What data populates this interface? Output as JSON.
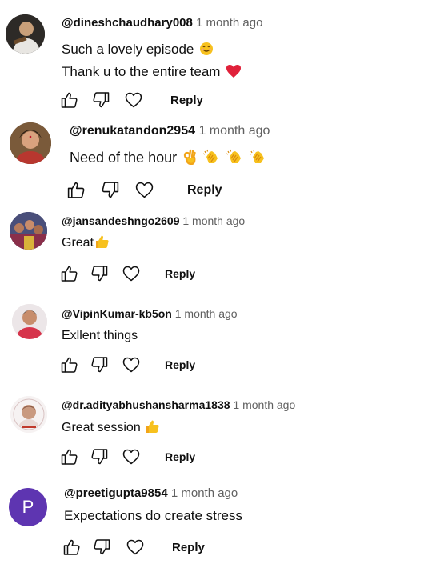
{
  "comments": [
    {
      "author": "@dineshchaudhary008",
      "time": "1 month ago",
      "lines": [
        "Such a lovely episode",
        "Thank u to the entire team"
      ],
      "reply_label": "Reply"
    },
    {
      "author": "@renukatandon2954",
      "time": "1 month ago",
      "lines": [
        "Need of the hour"
      ],
      "reply_label": "Reply"
    },
    {
      "author": "@jansandeshngo2609",
      "time": "1 month ago",
      "lines": [
        "Great"
      ],
      "reply_label": "Reply"
    },
    {
      "author": "@VipinKumar-kb5on",
      "time": "1 month ago",
      "lines": [
        "Exllent things"
      ],
      "reply_label": "Reply"
    },
    {
      "author": "@dr.adityabhushansharma1838",
      "time": "1 month ago",
      "lines": [
        "Great session"
      ],
      "reply_label": "Reply"
    },
    {
      "author": "@preetigupta9854",
      "time": "1 month ago",
      "lines": [
        "Expectations do create stress"
      ],
      "reply_label": "Reply",
      "avatar_letter": "P"
    }
  ],
  "colors": {
    "avatar_purple": "#5e35b1",
    "emoji_yellow": "#f7c11e",
    "heart_red": "#e0213a"
  },
  "icons": [
    "thumbs-up-icon",
    "thumbs-down-icon",
    "heart-icon",
    "smiling-face-emoji",
    "red-heart-emoji",
    "ok-hand-emoji",
    "clapping-hands-emoji",
    "thumbs-up-emoji"
  ]
}
